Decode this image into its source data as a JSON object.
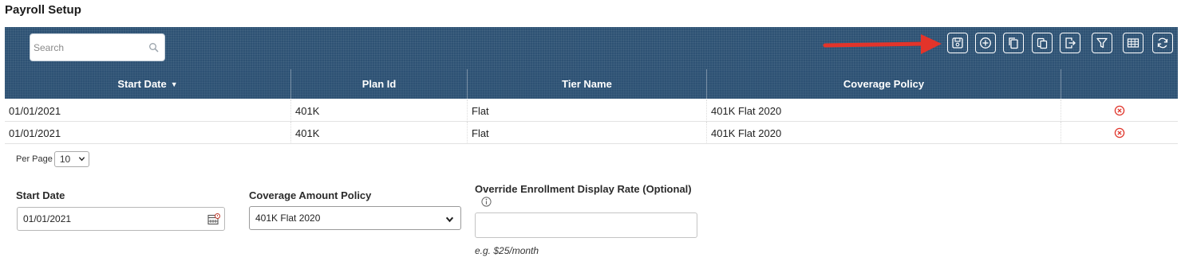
{
  "page": {
    "title": "Payroll Setup"
  },
  "toolbar": {
    "search_placeholder": "Search",
    "buttons": [
      {
        "icon": "save-icon"
      },
      {
        "icon": "add-icon"
      },
      {
        "icon": "copy-icon"
      },
      {
        "icon": "paste-icon"
      },
      {
        "icon": "export-icon"
      },
      {
        "icon": "filter-icon"
      },
      {
        "icon": "columns-icon"
      },
      {
        "icon": "refresh-icon"
      }
    ],
    "annotation_arrow_color": "#e3342a"
  },
  "grid": {
    "columns": [
      "Start Date",
      "Plan Id",
      "Tier Name",
      "Coverage Policy",
      ""
    ],
    "sort_indicator": "▼",
    "rows": [
      {
        "start_date": "01/01/2021",
        "plan_id": "401K",
        "tier_name": "Flat",
        "coverage_policy": "401K Flat 2020"
      },
      {
        "start_date": "01/01/2021",
        "plan_id": "401K",
        "tier_name": "Flat",
        "coverage_policy": "401K Flat 2020"
      }
    ]
  },
  "pagination": {
    "per_page_label": "Per Page",
    "per_page_value": "10"
  },
  "form": {
    "start_date_label": "Start Date",
    "start_date_value": "01/01/2021",
    "coverage_label": "Coverage Amount Policy",
    "coverage_value": "401K Flat 2020",
    "override_label": "Override Enrollment Display Rate (Optional)",
    "override_value": "",
    "override_hint": "e.g. $25/month"
  },
  "colors": {
    "header_bg": "#2e5274",
    "delete_icon": "#e0352b"
  }
}
